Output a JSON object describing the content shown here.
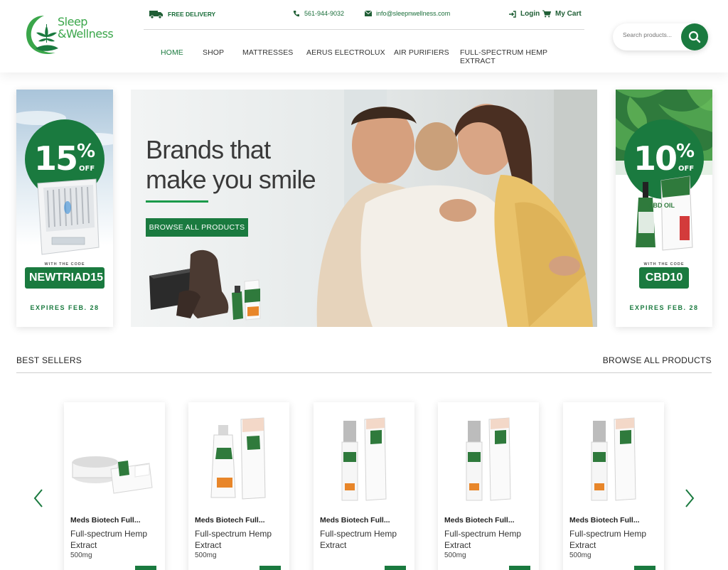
{
  "header": {
    "logo": {
      "line1": "Sleep",
      "line2": "&Wellness"
    },
    "topbar": {
      "delivery": "FREE DELIVERY",
      "phone": "561-944-9032",
      "email": "info@sleepnwellness.com",
      "login": "Login",
      "cart": "My Cart"
    },
    "nav": [
      "HOME",
      "SHOP",
      "MATTRESSES",
      "AERUS ELECTROLUX",
      "AIR PURIFIERS",
      "FULL-SPECTRUM HEMP EXTRACT"
    ],
    "search": {
      "placeholder": "Search products..."
    }
  },
  "promo_left": {
    "number": "15",
    "percent": "%",
    "off": "OFF",
    "with_code": "WITH THE CODE",
    "code": "NEWTRIAD15",
    "expires": "EXPIRES FEB. 28"
  },
  "promo_right": {
    "number": "10",
    "percent": "%",
    "off": "OFF",
    "with_code": "WITH THE CODE",
    "code": "CBD10",
    "expires": "EXPIRES FEB. 28",
    "product_label": "CBD OIL"
  },
  "hero": {
    "title_line1": "Brands that",
    "title_line2": "make you smile",
    "button": "BROWSE ALL PRODUCTS"
  },
  "best_sellers": {
    "title": "BEST SELLERS",
    "browse_link": "BROWSE ALL PRODUCTS",
    "products": [
      {
        "brand": "Meds Biotech Full...",
        "name": "Full-spectrum Hemp Extract",
        "size": "500mg"
      },
      {
        "brand": "Meds Biotech Full...",
        "name": "Full-spectrum Hemp Extract",
        "size": "500mg"
      },
      {
        "brand": "Meds Biotech Full...",
        "name": "Full-spectrum Hemp Extract",
        "size": ""
      },
      {
        "brand": "Meds Biotech Full...",
        "name": "Full-spectrum Hemp Extract",
        "size": "500mg"
      },
      {
        "brand": "Meds Biotech Full...",
        "name": "Full-spectrum Hemp Extract",
        "size": "500mg"
      }
    ]
  },
  "colors": {
    "brand_green": "#1a7a3f",
    "light_green": "#3aa64a",
    "accent_orange": "#e8862a"
  }
}
